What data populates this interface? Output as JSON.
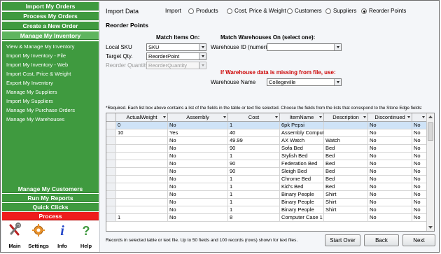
{
  "sidebar": {
    "nav": [
      {
        "label": "Import My Orders"
      },
      {
        "label": "Process My Orders"
      },
      {
        "label": "Create a New Order"
      },
      {
        "label": "Manage My Inventory"
      }
    ],
    "sub_items": [
      "View & Manage My Inventory",
      "Import My Inventory - File",
      "Import My Inventory - Web",
      "Import Cost, Price & Weight",
      "Export My Inventory",
      "Manage My Suppliers",
      "Import My Suppliers",
      "Manage My Purchase Orders",
      "Manage My Warehouses"
    ],
    "bottom_nav": [
      {
        "label": "Manage My Customers"
      },
      {
        "label": "Run My Reports"
      },
      {
        "label": "Quick Clicks"
      },
      {
        "label": "Process"
      }
    ],
    "toolbar": [
      {
        "label": "Main",
        "icon": "tools-icon"
      },
      {
        "label": "Settings",
        "icon": "gear-icon"
      },
      {
        "label": "Info",
        "icon": "info-icon"
      },
      {
        "label": "Help",
        "icon": "help-icon"
      }
    ]
  },
  "header": {
    "title": "Import Data",
    "import_label": "Import",
    "options": [
      "Products",
      "Cost, Price & Weight",
      "Customers",
      "Suppliers",
      "Reorder Points"
    ],
    "selected_option": "Reorder Points"
  },
  "section_title": "Reorder Points",
  "match_items": {
    "heading": "Match Items On:",
    "fields": [
      {
        "label": "Local SKU",
        "value": "SKU",
        "disabled": false
      },
      {
        "label": "Target Qty.",
        "value": "ReorderPoint",
        "disabled": false
      },
      {
        "label": "Reorder Quantity",
        "value": "ReorderQuantity",
        "disabled": true
      }
    ]
  },
  "match_warehouses": {
    "heading": "Match Warehouses On (select one):",
    "id_label": "Warehouse ID (numeric)",
    "id_value": "",
    "missing_warning": "If Warehouse data is missing from file, use:",
    "name_label": "Warehouse Name",
    "name_value": "Collegeville"
  },
  "note": "*Required. Each list box above contains a list of the fields in the table or text file selected. Choose the fields from the lists that correspond to the Stone Edge fields:",
  "grid": {
    "columns": [
      "ActualWeight",
      "Assembly",
      "Cost",
      "ItemName",
      "Description",
      "Discontinued",
      ""
    ],
    "rows": [
      [
        "0",
        "No",
        "1",
        "6pk Pepsi",
        "",
        "No",
        "No"
      ],
      [
        "10",
        "Yes",
        "40",
        "Assembly Compute",
        "",
        "No",
        "No"
      ],
      [
        "",
        "No",
        "49.99",
        "AX Watch",
        "Watch",
        "No",
        "No"
      ],
      [
        "",
        "No",
        "90",
        "Sofa Bed",
        "Bed",
        "No",
        "No"
      ],
      [
        "",
        "No",
        "1",
        "Stylish Bed",
        "Bed",
        "No",
        "No"
      ],
      [
        "",
        "No",
        "90",
        "Federation Bed",
        "Bed",
        "No",
        "No"
      ],
      [
        "",
        "No",
        "90",
        "Sleigh Bed",
        "Bed",
        "No",
        "No"
      ],
      [
        "",
        "No",
        "1",
        "Chrome Bed",
        "Bed",
        "No",
        "No"
      ],
      [
        "",
        "No",
        "1",
        "Kid's Bed",
        "Bed",
        "No",
        "No"
      ],
      [
        "",
        "No",
        "1",
        "Binary People",
        "Shirt",
        "No",
        "No"
      ],
      [
        "",
        "No",
        "1",
        "Binary People",
        "Shirt",
        "No",
        "No"
      ],
      [
        "",
        "No",
        "1",
        "Binary People",
        "Shirt",
        "No",
        "No"
      ],
      [
        "1",
        "No",
        "8",
        "Computer Case 1",
        "",
        "No",
        "No"
      ]
    ]
  },
  "footer": {
    "status": "Records in selected table or text file. Up to 50 fields and 100 records (rows) shown for text files.",
    "buttons": [
      "Start Over",
      "Back",
      "Next"
    ]
  },
  "colors": {
    "nav_green": "#3f9a3f",
    "nav_active": "#5fb55f",
    "process_red": "#ee1c1c",
    "warning_red": "#cc0000",
    "selected_row": "#cfe3f7"
  }
}
